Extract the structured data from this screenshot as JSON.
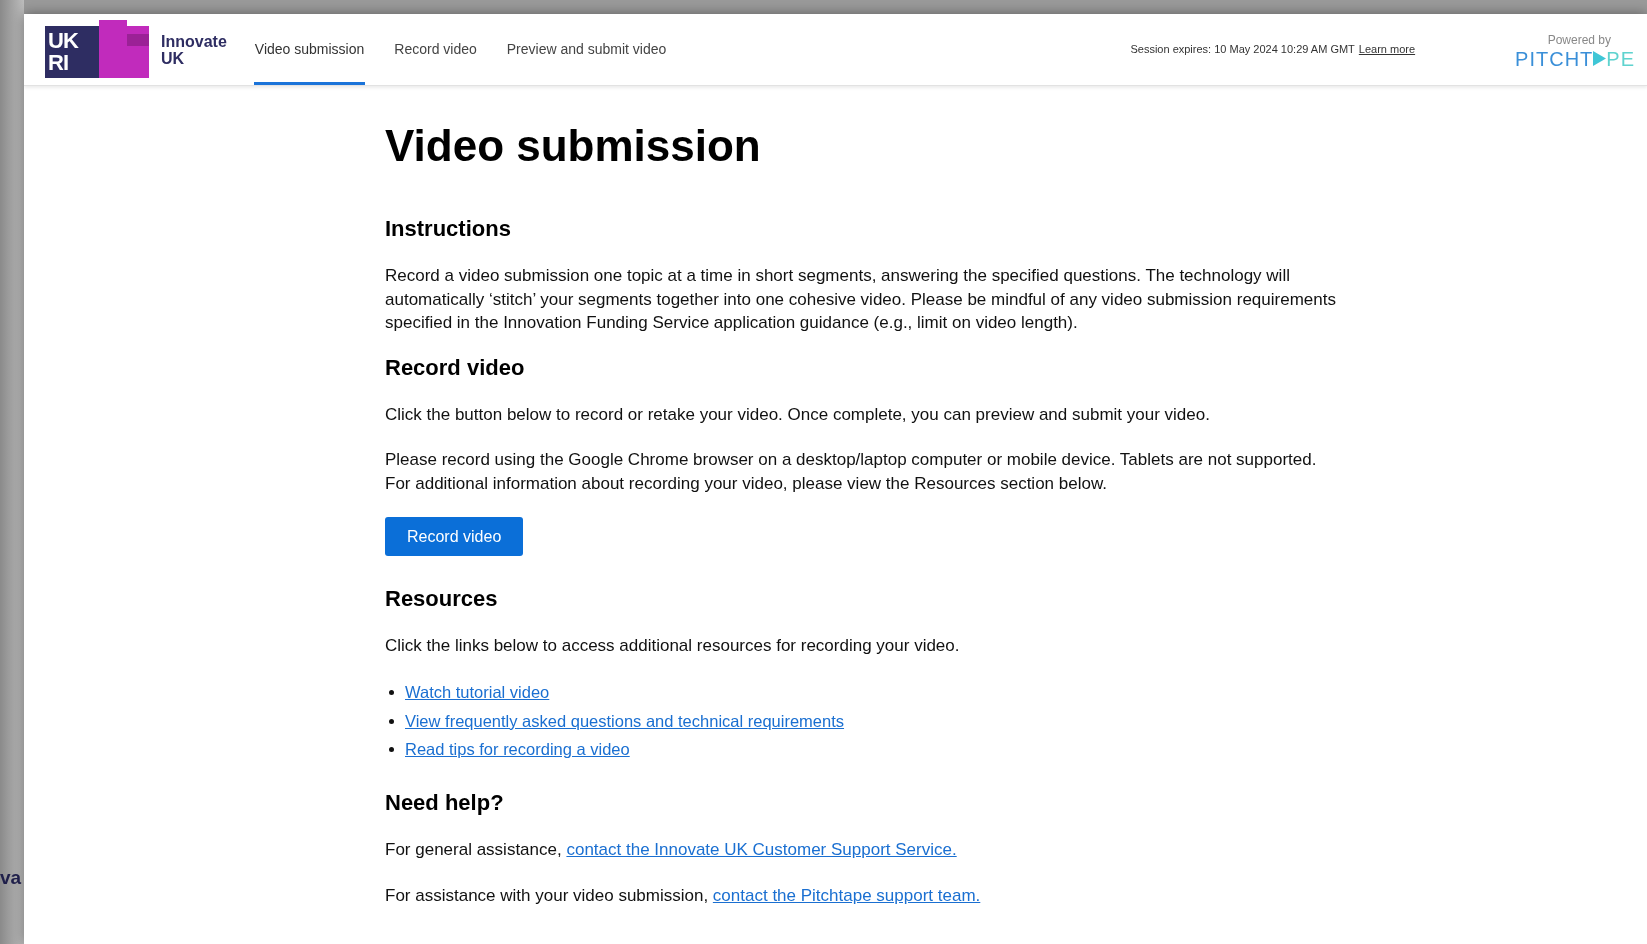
{
  "backdrop": {
    "text": "va"
  },
  "header": {
    "logo": {
      "letters_top": "UK",
      "letters_bottom": "RI",
      "name_line1": "Innovate",
      "name_line2": "UK"
    },
    "tabs": [
      {
        "label": "Video submission",
        "selected": true
      },
      {
        "label": "Record video",
        "selected": false
      },
      {
        "label": "Preview and submit video",
        "selected": false
      }
    ],
    "session": {
      "text": "Session expires: 10 May 2024 10:29 AM GMT",
      "link": "Learn more"
    },
    "powered_by": {
      "label": "Powered by",
      "brand_start": "PITCHT",
      "brand_end": "PE"
    }
  },
  "page_title": "Video submission",
  "sections": [
    {
      "heading": "Instructions",
      "blocks": [
        {
          "kind": "paragraph",
          "text": "Record a video submission one topic at a time in short segments, answering the specified questions. The technology will automatically ‘stitch’ your segments together into one cohesive video. Please be mindful of any video submission requirements specified in the Innovation Funding Service application guidance (e.g., limit on video length)."
        }
      ]
    },
    {
      "heading": "Record video",
      "blocks": [
        {
          "kind": "paragraph",
          "text": "Click the button below to record or retake your video. Once complete, you can preview and submit your video."
        },
        {
          "kind": "paragraph",
          "text": "Please record using the Google Chrome browser on a desktop/laptop computer or mobile device. Tablets are not supported. For additional information about recording your video, please view the Resources section below."
        },
        {
          "kind": "button",
          "text": "Record video"
        }
      ]
    },
    {
      "heading": "Resources",
      "blocks": [
        {
          "kind": "paragraph",
          "text": "Click the links below to access additional resources for recording your video."
        },
        {
          "kind": "links",
          "items": [
            "Watch tutorial video",
            "View frequently asked questions and technical requirements",
            "Read tips for recording a video"
          ]
        }
      ]
    },
    {
      "heading": "Need help?",
      "blocks": [
        {
          "kind": "paragraph",
          "text": "For general assistance, ",
          "link": "contact the Innovate UK Customer Support Service."
        },
        {
          "kind": "paragraph",
          "text": "For assistance with your video submission, ",
          "link": "contact the Pitchtape support team."
        }
      ]
    }
  ]
}
